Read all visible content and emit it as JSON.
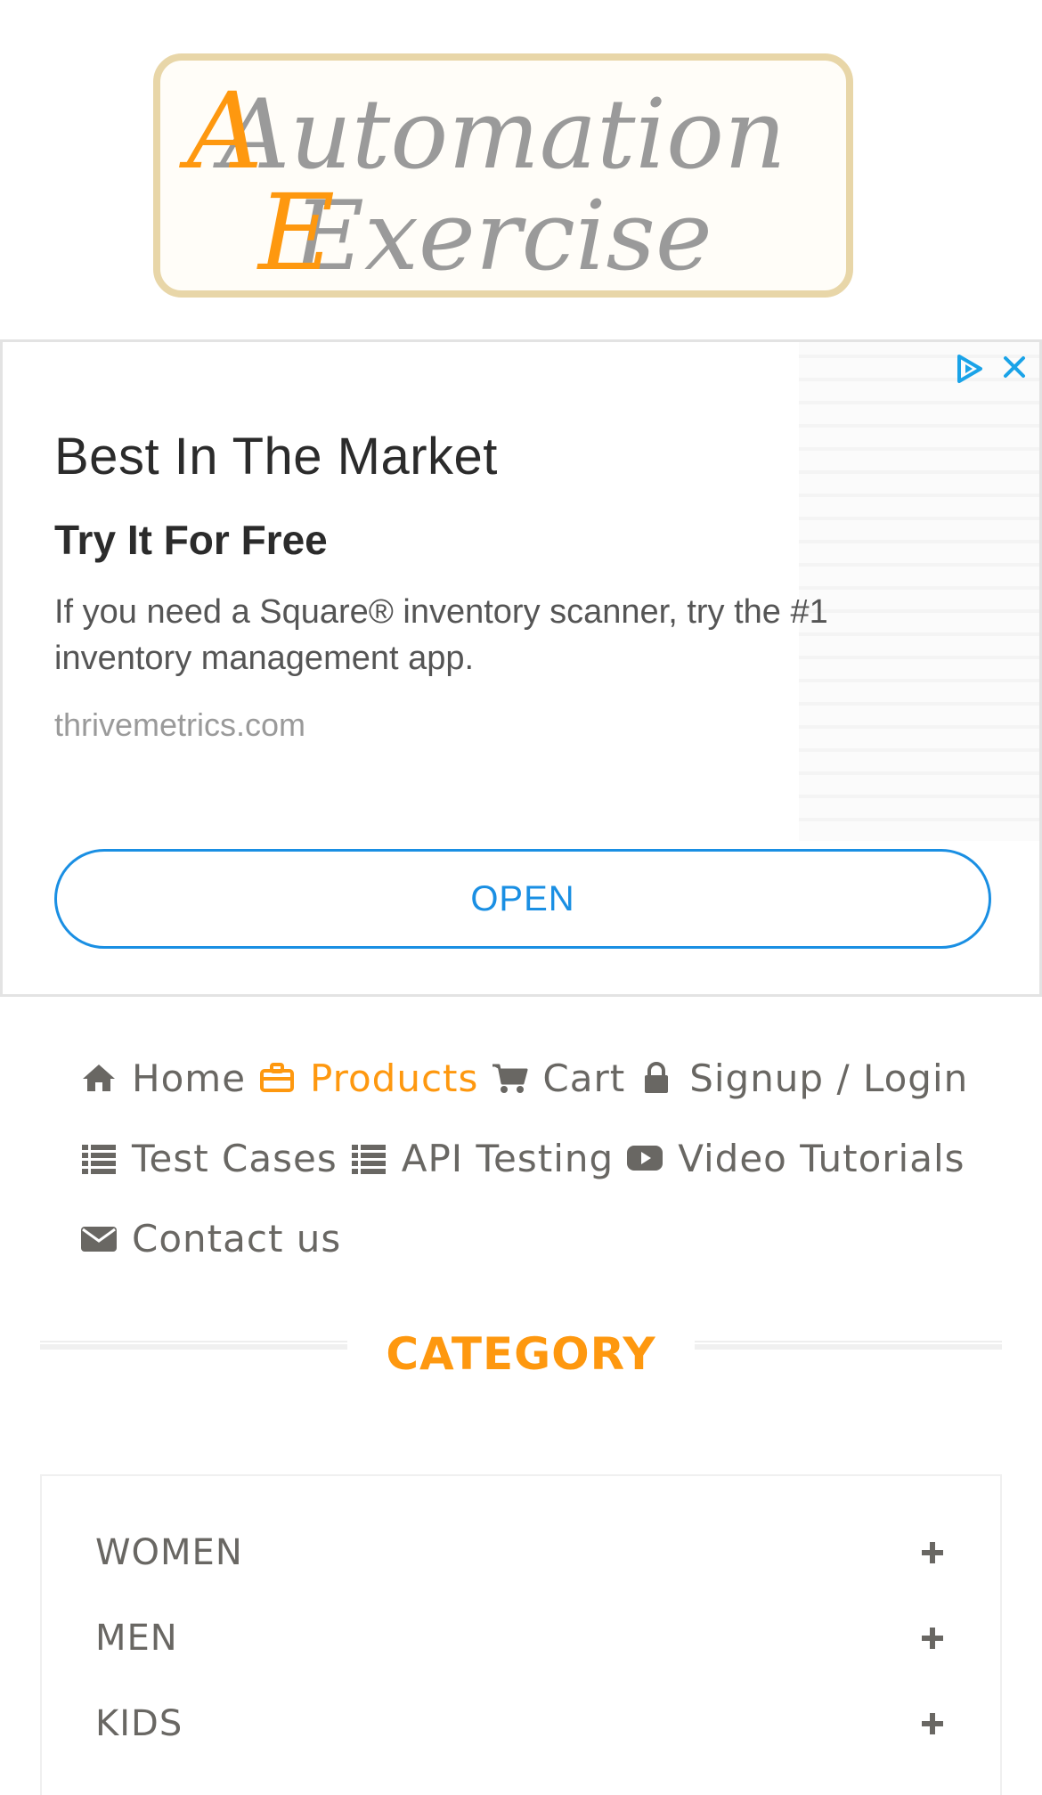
{
  "logo": {
    "line1": "Automation",
    "line2": "Exercise",
    "accent_color": "#fe980f",
    "frame_color": "#e8d6a8"
  },
  "ad": {
    "headline": "Best In The Market",
    "subheadline": "Try It For Free",
    "body": "If you need a Square® inventory scanner, try the #1 inventory management app.",
    "domain": "thrivemetrics.com",
    "cta_label": "OPEN",
    "cta_color": "#1a8fe3",
    "choices_icon": "adchoices-icon",
    "close_icon": "close-icon"
  },
  "nav": {
    "active_color": "#fe980f",
    "items": [
      {
        "label": "Home",
        "icon": "home-icon"
      },
      {
        "label": "Products",
        "icon": "briefcase-icon"
      },
      {
        "label": "Cart",
        "icon": "cart-icon"
      },
      {
        "label": "Signup / Login",
        "icon": "lock-icon"
      },
      {
        "label": "Test Cases",
        "icon": "list-icon"
      },
      {
        "label": "API Testing",
        "icon": "list-icon"
      },
      {
        "label": "Video Tutorials",
        "icon": "youtube-play-icon"
      },
      {
        "label": "Contact us",
        "icon": "envelope-icon"
      }
    ]
  },
  "category": {
    "title": "CATEGORY",
    "items": [
      {
        "label": "WOMEN",
        "icon": "plus-icon"
      },
      {
        "label": "MEN",
        "icon": "plus-icon"
      },
      {
        "label": "KIDS",
        "icon": "plus-icon"
      }
    ]
  }
}
